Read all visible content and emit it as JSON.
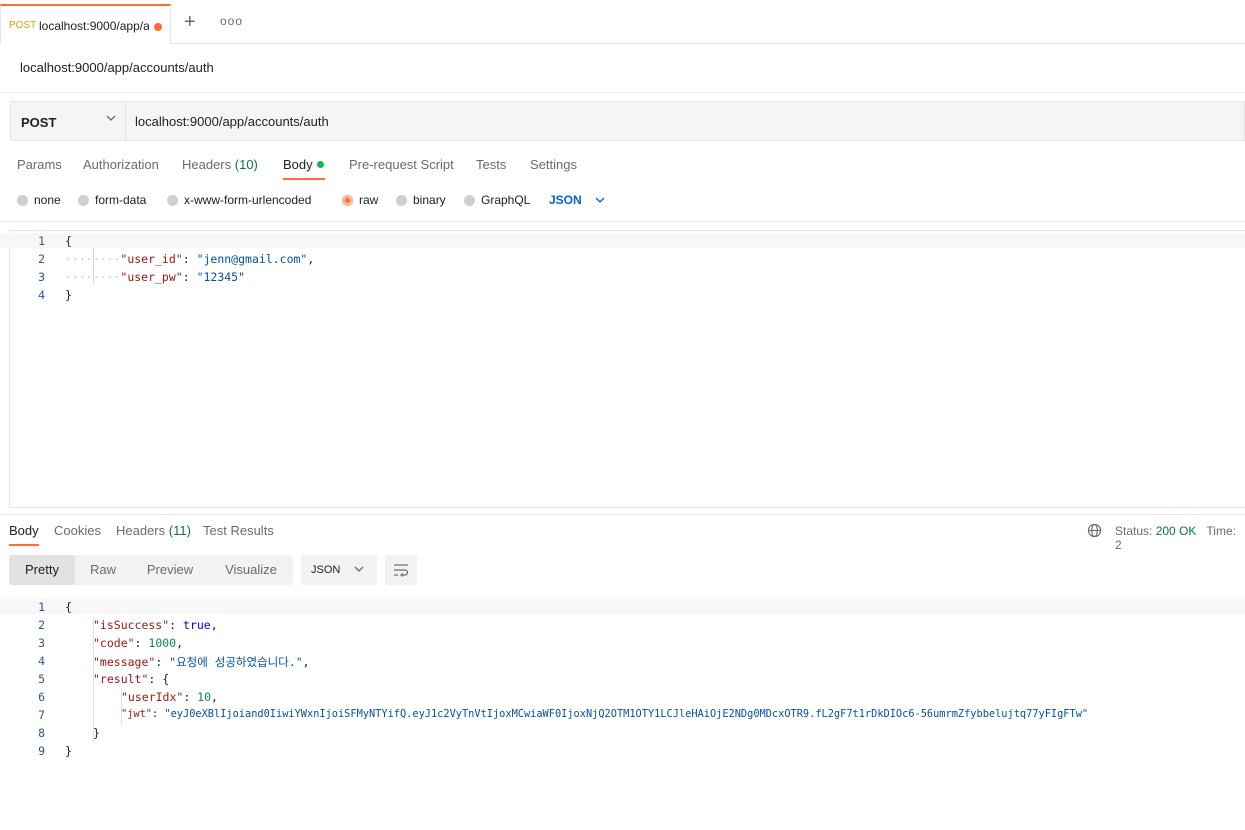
{
  "tab": {
    "method": "POST",
    "title": "localhost:9000/app/a"
  },
  "request_name": "localhost:9000/app/accounts/auth",
  "request": {
    "method": "POST",
    "url": "localhost:9000/app/accounts/auth"
  },
  "request_tabs": {
    "params": "Params",
    "authorization": "Authorization",
    "headers": "Headers",
    "headers_count": "(10)",
    "body": "Body",
    "prerequest": "Pre-request Script",
    "tests": "Tests",
    "settings": "Settings"
  },
  "body_types": {
    "none": "none",
    "form_data": "form-data",
    "urlencoded": "x-www-form-urlencoded",
    "raw": "raw",
    "binary": "binary",
    "graphql": "GraphQL",
    "selected_format": "JSON"
  },
  "request_body": {
    "line_numbers": [
      "1",
      "2",
      "3",
      "4"
    ],
    "open_brace": "{",
    "close_brace": "}",
    "indent_dots": "········",
    "user_id_key": "\"user_id\"",
    "user_id_value": "\"jenn@gmail.com\"",
    "user_pw_key": "\"user_pw\"",
    "user_pw_value": "\"12345\""
  },
  "response_tabs": {
    "body": "Body",
    "cookies": "Cookies",
    "headers": "Headers",
    "headers_count": "(11)",
    "test_results": "Test Results"
  },
  "status": {
    "label": "Status:",
    "value": "200 OK",
    "time_label": "Time: 2"
  },
  "view_modes": {
    "pretty": "Pretty",
    "raw": "Raw",
    "preview": "Preview",
    "visualize": "Visualize"
  },
  "response_format": "JSON",
  "response_body": {
    "line_numbers": [
      "1",
      "2",
      "3",
      "4",
      "5",
      "6",
      "7",
      "8",
      "9"
    ],
    "open_brace": "{",
    "close_brace": "}",
    "is_success_key": "\"isSuccess\"",
    "is_success_value": "true",
    "code_key": "\"code\"",
    "code_value": "1000",
    "message_key": "\"message\"",
    "message_value": "\"요청에 성공하였습니다.\"",
    "result_key": "\"result\"",
    "user_idx_key": "\"userIdx\"",
    "user_idx_value": "10",
    "jwt_key": "\"jwt\"",
    "jwt_value": "\"eyJ0eXBlIjoiand0IiwiYWxnIjoiSFMyNTYifQ.eyJ1c2VyTnVtIjoxMCwiaWF0IjoxNjQ2OTM1OTY1LCJleHAiOjE2NDg0MDcxOTR9.fL2gF7t1rDkDIOc6-56umrmZfybbelujtq77yFIgFTw\""
  },
  "colors": {
    "accent": "#ff6c37",
    "status_ok": "#0a7a36",
    "link_blue": "#0265d2"
  }
}
